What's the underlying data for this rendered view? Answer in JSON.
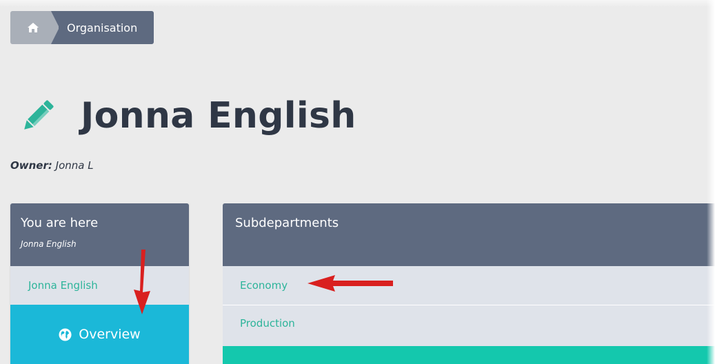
{
  "breadcrumb": {
    "home_icon": "home-icon",
    "current": "Organisation"
  },
  "header": {
    "title": "Jonna English",
    "title_icon": "pencil-icon",
    "owner_label": "Owner:",
    "owner_value": "Jonna L"
  },
  "left_panel": {
    "title": "You are here",
    "subtitle": "Jonna English",
    "link": "Jonna English",
    "overview_label": "Overview",
    "overview_icon": "globe-icon"
  },
  "right_panel": {
    "title": "Subdepartments",
    "items": [
      {
        "label": "Economy"
      },
      {
        "label": "Production"
      }
    ]
  },
  "colors": {
    "panel_header": "#5e6a80",
    "link_green": "#2db49a",
    "overview_blue": "#1bb8d8",
    "teal_bar": "#14c8ad",
    "annotation_arrow": "#d9201f",
    "pencil": "#2db49a"
  }
}
